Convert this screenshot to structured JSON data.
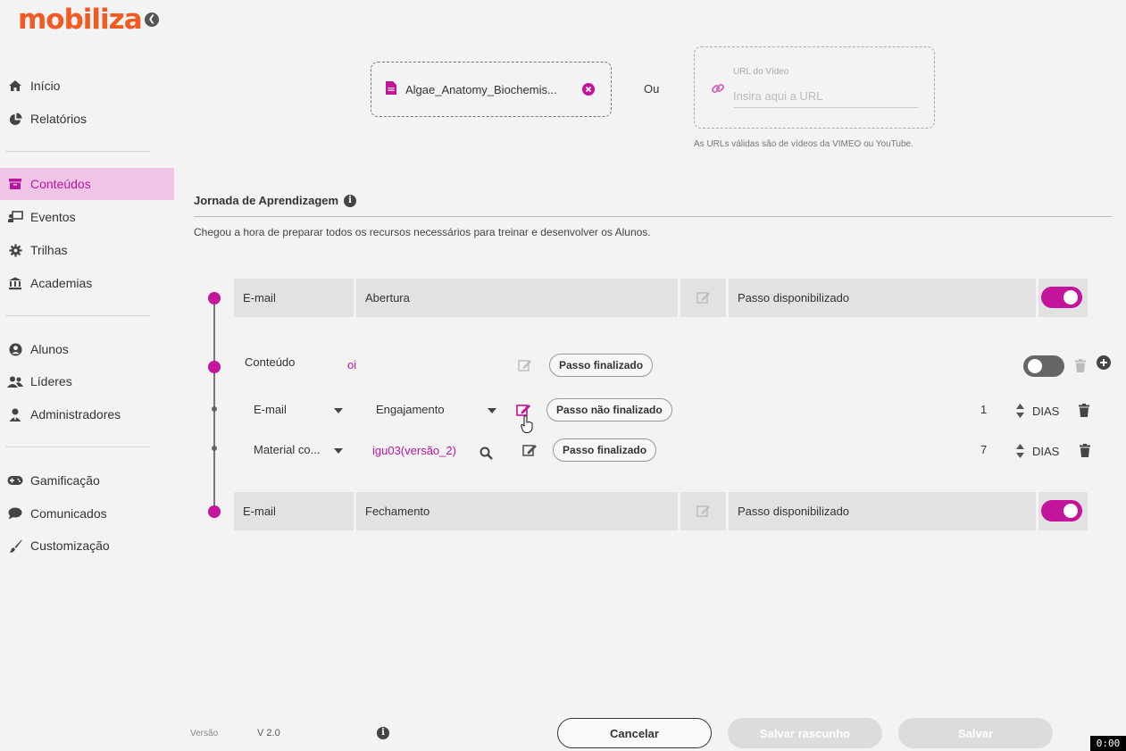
{
  "brand": {
    "logo": "mobiliza",
    "accent": "#c3149b",
    "logo_color": "#f15a22"
  },
  "sidebar": {
    "items": [
      {
        "label": "Início",
        "icon": "home-icon"
      },
      {
        "label": "Relatórios",
        "icon": "pie-chart-icon"
      },
      {
        "label": "Conteúdos",
        "icon": "archive-box-icon",
        "active": true
      },
      {
        "label": "Eventos",
        "icon": "presentation-icon"
      },
      {
        "label": "Trilhas",
        "icon": "gear-icon"
      },
      {
        "label": "Academias",
        "icon": "institution-icon"
      },
      {
        "label": "Alunos",
        "icon": "user-circle-icon"
      },
      {
        "label": "Líderes",
        "icon": "users-icon"
      },
      {
        "label": "Administradores",
        "icon": "user-tie-icon"
      },
      {
        "label": "Gamificação",
        "icon": "gamepad-icon"
      },
      {
        "label": "Comunicados",
        "icon": "chat-bubble-icon"
      },
      {
        "label": "Customização",
        "icon": "paintbrush-icon"
      }
    ]
  },
  "upload": {
    "file_name": "Algae_Anatomy_Biochemis...",
    "or_text": "Ou",
    "url_label": "URL do Vídeo",
    "url_placeholder": "Insira aqui a URL",
    "url_hint": "As URLs válidas são de vídeos da VIMEO ou YouTube."
  },
  "journey": {
    "title": "Jornada de Aprendizagem",
    "description": "Chegou a hora de preparar todos os recursos necessários para treinar e desenvolver os Alunos.",
    "opening": {
      "type": "E-mail",
      "name": "Abertura",
      "status": "Passo disponibilizado",
      "enabled": true
    },
    "content": {
      "label": "Conteúdo",
      "value": "oi",
      "status": "Passo finalizado",
      "enabled": false
    },
    "steps": [
      {
        "type": "E-mail",
        "template": "Engajamento",
        "status": "Passo não finalizado",
        "days": "1",
        "unit": "DIAS"
      },
      {
        "type": "Material co...",
        "template": "igu03(versão_2)",
        "status": "Passo finalizado",
        "days": "7",
        "unit": "DIAS"
      }
    ],
    "closing": {
      "type": "E-mail",
      "name": "Fechamento",
      "status": "Passo disponibilizado",
      "enabled": true
    }
  },
  "footer": {
    "version_label": "Versão",
    "version": "V 2.0",
    "cancel": "Cancelar",
    "save_draft": "Salvar rascunho",
    "save": "Salvar"
  },
  "overlay": {
    "time": "0:00"
  }
}
